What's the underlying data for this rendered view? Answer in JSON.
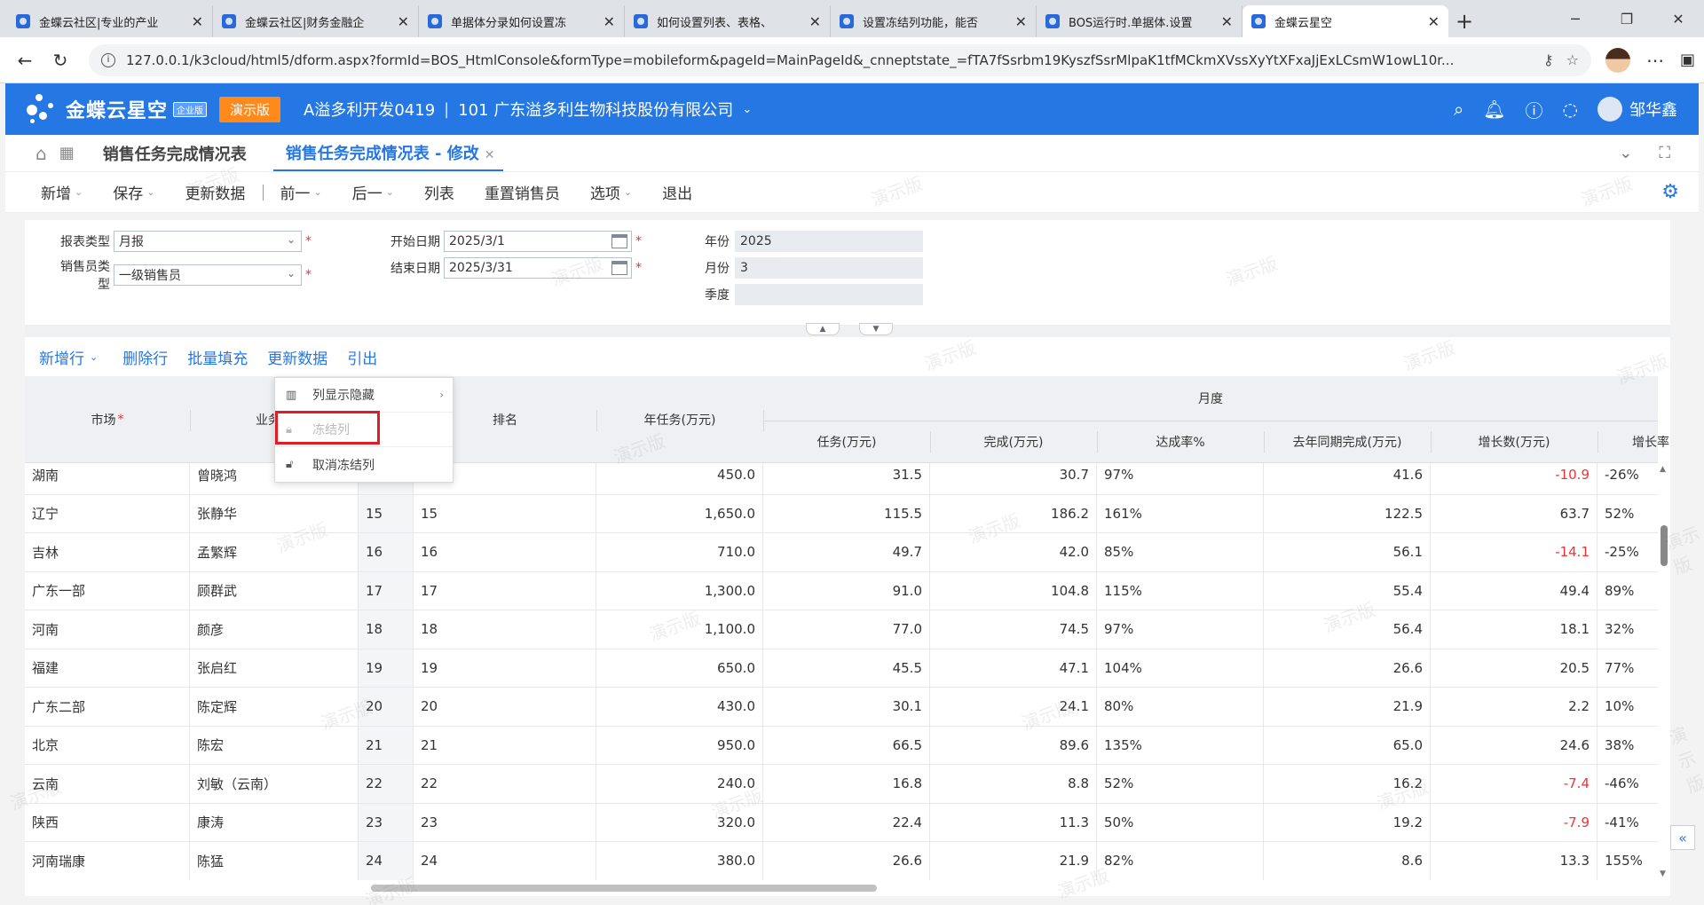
{
  "browser": {
    "tabs": [
      {
        "title": "金蝶云社区|专业的产业"
      },
      {
        "title": "金蝶云社区|财务金融企"
      },
      {
        "title": "单据体分录如何设置冻"
      },
      {
        "title": "如何设置列表、表格、"
      },
      {
        "title": "设置冻结列功能，能否"
      },
      {
        "title": "BOS运行时.单据体.设置"
      },
      {
        "title": "金蝶云星空"
      }
    ],
    "url": "127.0.0.1/k3cloud/html5/dform.aspx?formId=BOS_HtmlConsole&formType=mobileform&pageId=MainPageId&_cnneptstate_=fTA7fSsrbm19KyszfSsrMlpaK1tfMCkmXVssXyYtXFxaJjExLCsmW1owL10r..."
  },
  "app": {
    "logo_text": "金蝶云星空",
    "logo_badge": "企业版",
    "demo_badge": "演示版",
    "org_code": "A溢多利开发0419",
    "org_name": "101 广东溢多利生物科技股份有限公司",
    "user_name": "邹华鑫",
    "brand_color": "#2577e3"
  },
  "page_tabs": [
    {
      "label": "销售任务完成情况表"
    },
    {
      "label": "销售任务完成情况表 - 修改"
    }
  ],
  "toolbar": {
    "new": "新增",
    "save": "保存",
    "update_data": "更新数据",
    "prev": "前一",
    "next": "后一",
    "list": "列表",
    "reset_sales": "重置销售员",
    "options": "选项",
    "exit": "退出"
  },
  "form": {
    "report_type_label": "报表类型",
    "report_type_value": "月报",
    "sales_type_label": "销售员类型",
    "sales_type_value": "一级销售员",
    "start_date_label": "开始日期",
    "start_date_value": "2025/3/1",
    "end_date_label": "结束日期",
    "end_date_value": "2025/3/31",
    "year_label": "年份",
    "year_value": "2025",
    "month_label": "月份",
    "month_value": "3",
    "quarter_label": "季度",
    "quarter_value": ""
  },
  "grid_actions": {
    "add_row": "新增行",
    "delete_row": "删除行",
    "batch_fill": "批量填充",
    "update_data": "更新数据",
    "export": "引出"
  },
  "table": {
    "headers": {
      "market": "市场",
      "salesperson": "业务经",
      "rank": "排名",
      "annual_task": "年任务(万元)",
      "monthly_group": "月度",
      "task": "任务(万元)",
      "completed": "完成(万元)",
      "rate": "达成率%",
      "last_year": "去年同期完成(万元)",
      "growth_amount": "增长数(万元)",
      "growth_rate": "增长率"
    },
    "rows": [
      {
        "market": "湖南",
        "salesperson": "曾晓鸿",
        "seq": "",
        "rank": "",
        "annual": "450.0",
        "task": "31.5",
        "completed": "30.7",
        "rate": "97%",
        "last_year": "41.6",
        "growth": "-10.9",
        "growth_rate": "-26%"
      },
      {
        "market": "辽宁",
        "salesperson": "张静华",
        "seq": "15",
        "rank": "15",
        "annual": "1,650.0",
        "task": "115.5",
        "completed": "186.2",
        "rate": "161%",
        "last_year": "122.5",
        "growth": "63.7",
        "growth_rate": "52%"
      },
      {
        "market": "吉林",
        "salesperson": "孟繁辉",
        "seq": "16",
        "rank": "16",
        "annual": "710.0",
        "task": "49.7",
        "completed": "42.0",
        "rate": "85%",
        "last_year": "56.1",
        "growth": "-14.1",
        "growth_rate": "-25%"
      },
      {
        "market": "广东一部",
        "salesperson": "顾群武",
        "seq": "17",
        "rank": "17",
        "annual": "1,300.0",
        "task": "91.0",
        "completed": "104.8",
        "rate": "115%",
        "last_year": "55.4",
        "growth": "49.4",
        "growth_rate": "89%"
      },
      {
        "market": "河南",
        "salesperson": "颜彦",
        "seq": "18",
        "rank": "18",
        "annual": "1,100.0",
        "task": "77.0",
        "completed": "74.5",
        "rate": "97%",
        "last_year": "56.4",
        "growth": "18.1",
        "growth_rate": "32%"
      },
      {
        "market": "福建",
        "salesperson": "张启红",
        "seq": "19",
        "rank": "19",
        "annual": "650.0",
        "task": "45.5",
        "completed": "47.1",
        "rate": "104%",
        "last_year": "26.6",
        "growth": "20.5",
        "growth_rate": "77%"
      },
      {
        "market": "广东二部",
        "salesperson": "陈定辉",
        "seq": "20",
        "rank": "20",
        "annual": "430.0",
        "task": "30.1",
        "completed": "24.1",
        "rate": "80%",
        "last_year": "21.9",
        "growth": "2.2",
        "growth_rate": "10%"
      },
      {
        "market": "北京",
        "salesperson": "陈宏",
        "seq": "21",
        "rank": "21",
        "annual": "950.0",
        "task": "66.5",
        "completed": "89.6",
        "rate": "135%",
        "last_year": "65.0",
        "growth": "24.6",
        "growth_rate": "38%"
      },
      {
        "market": "云南",
        "salesperson": "刘敏（云南）",
        "seq": "22",
        "rank": "22",
        "annual": "240.0",
        "task": "16.8",
        "completed": "8.8",
        "rate": "52%",
        "last_year": "16.2",
        "growth": "-7.4",
        "growth_rate": "-46%"
      },
      {
        "market": "陕西",
        "salesperson": "康涛",
        "seq": "23",
        "rank": "23",
        "annual": "320.0",
        "task": "22.4",
        "completed": "11.3",
        "rate": "50%",
        "last_year": "19.2",
        "growth": "-7.9",
        "growth_rate": "-41%"
      },
      {
        "market": "河南瑞康",
        "salesperson": "陈猛",
        "seq": "24",
        "rank": "24",
        "annual": "380.0",
        "task": "26.6",
        "completed": "21.9",
        "rate": "82%",
        "last_year": "8.6",
        "growth": "13.3",
        "growth_rate": "155%"
      }
    ]
  },
  "context_menu": {
    "items": [
      {
        "label": "列显示隐藏",
        "icon": "columns-icon",
        "disabled": false,
        "has_submenu": true
      },
      {
        "label": "冻结列",
        "icon": "lock-icon",
        "disabled": true,
        "has_submenu": false
      },
      {
        "label": "取消冻结列",
        "icon": "unlock-icon",
        "disabled": false,
        "has_submenu": false
      }
    ]
  },
  "watermark_text": "演示版",
  "colors": {
    "accent": "#2577e3",
    "demo_badge": "#ff8a1a",
    "negative": "#e33333",
    "highlight_box": "#e31b23"
  }
}
